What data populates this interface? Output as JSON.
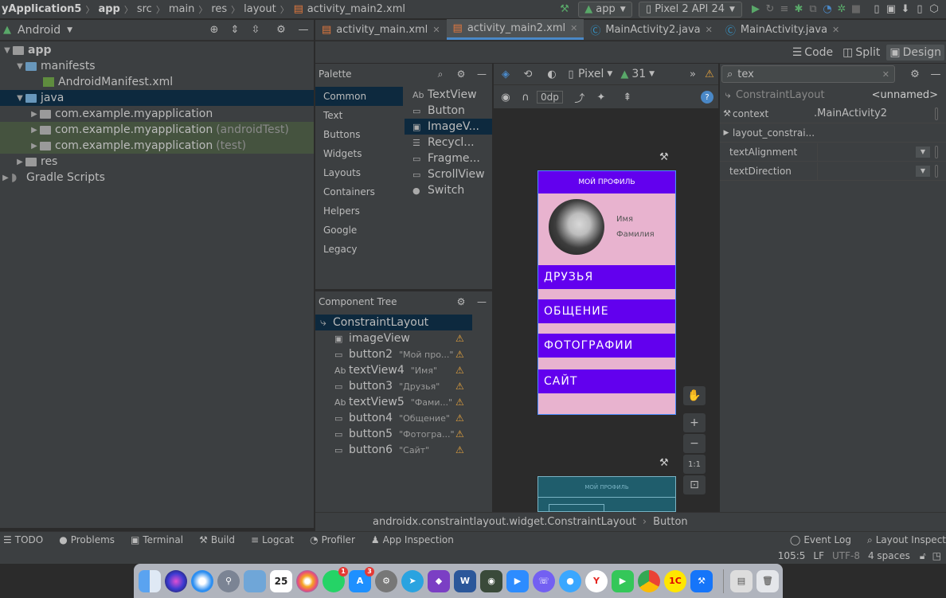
{
  "topbar": {
    "breadcrumb": [
      "yApplication5",
      "app",
      "src",
      "main",
      "res",
      "layout",
      "activity_main2.xml"
    ],
    "run_config": "app",
    "device": "Pixel 2 API 24"
  },
  "project": {
    "view_selector": "Android",
    "tree": [
      {
        "label": "app",
        "level": 0
      },
      {
        "label": "manifests",
        "level": 1
      },
      {
        "label": "AndroidManifest.xml",
        "level": 2
      },
      {
        "label": "java",
        "level": 1
      },
      {
        "label": "com.example.myapplication",
        "level": 2,
        "suffix": ""
      },
      {
        "label": "com.example.myapplication",
        "level": 2,
        "suffix": "(androidTest)"
      },
      {
        "label": "com.example.myapplication",
        "level": 2,
        "suffix": "(test)"
      },
      {
        "label": "res",
        "level": 1
      },
      {
        "label": "Gradle Scripts",
        "level": 0
      }
    ]
  },
  "editor_tabs": [
    {
      "label": "activity_main.xml",
      "active": false
    },
    {
      "label": "activity_main2.xml",
      "active": true
    },
    {
      "label": "MainActivity2.java",
      "active": false
    },
    {
      "label": "MainActivity.java",
      "active": false
    }
  ],
  "modes": {
    "code": "Code",
    "split": "Split",
    "design": "Design"
  },
  "palette": {
    "title": "Palette",
    "categories": [
      "Common",
      "Text",
      "Buttons",
      "Widgets",
      "Layouts",
      "Containers",
      "Helpers",
      "Google",
      "Legacy"
    ],
    "items": [
      {
        "icon": "Ab",
        "label": "TextView"
      },
      {
        "icon": "▭",
        "label": "Button"
      },
      {
        "icon": "▣",
        "label": "ImageV..."
      },
      {
        "icon": "☰",
        "label": "Recycl..."
      },
      {
        "icon": "▭",
        "label": "Fragme..."
      },
      {
        "icon": "▭",
        "label": "ScrollView"
      },
      {
        "icon": "●",
        "label": "Switch"
      }
    ]
  },
  "component_tree": {
    "title": "Component Tree",
    "root": "ConstraintLayout",
    "items": [
      {
        "icon": "▣",
        "label": "imageView",
        "sub": ""
      },
      {
        "icon": "▭",
        "label": "button2",
        "sub": "\"Мой про...\""
      },
      {
        "icon": "Ab",
        "label": "textView4",
        "sub": "\"Имя\""
      },
      {
        "icon": "▭",
        "label": "button3",
        "sub": "\"Друзья\""
      },
      {
        "icon": "Ab",
        "label": "textView5",
        "sub": "\"Фами...\""
      },
      {
        "icon": "▭",
        "label": "button4",
        "sub": "\"Общение\""
      },
      {
        "icon": "▭",
        "label": "button5",
        "sub": "\"Фотогра...\""
      },
      {
        "icon": "▭",
        "label": "button6",
        "sub": "\"Сайт\""
      }
    ]
  },
  "canvas": {
    "device": "Pixel",
    "api": "31",
    "margin": "0dp",
    "phone": {
      "header": "МОЙ ПРОФИЛЬ",
      "first_name": "Имя",
      "last_name": "Фамилия",
      "buttons": [
        "ДРУЗЬЯ",
        "ОБЩЕНИЕ",
        "ФОТОГРАФИИ",
        "САЙТ"
      ]
    },
    "blueprint_header": "МОЙ ПРОФИЛЬ",
    "zoom_one": "1:1"
  },
  "attributes": {
    "search": "tex",
    "component": "ConstraintLayout",
    "id": "<unnamed>",
    "rows": [
      {
        "name": "context",
        "value": ".MainActivity2"
      },
      {
        "name": "layout_constrai...",
        "value": ""
      },
      {
        "name": "textAlignment",
        "value": ""
      },
      {
        "name": "textDirection",
        "value": ""
      }
    ]
  },
  "breadcrumb": [
    "androidx.constraintlayout.widget.ConstraintLayout",
    "Button"
  ],
  "bottom_tools": [
    "TODO",
    "Problems",
    "Terminal",
    "Build",
    "Logcat",
    "Profiler",
    "App Inspection"
  ],
  "bottom_right": [
    "Event Log",
    "Layout Inspect"
  ],
  "status": {
    "position": "105:5",
    "line_sep": "LF",
    "encoding": "UTF-8",
    "indent": "4 spaces"
  },
  "dock": {
    "badges": {
      "whatsapp": "1",
      "appstore": "3"
    },
    "calendar_day": "25"
  }
}
